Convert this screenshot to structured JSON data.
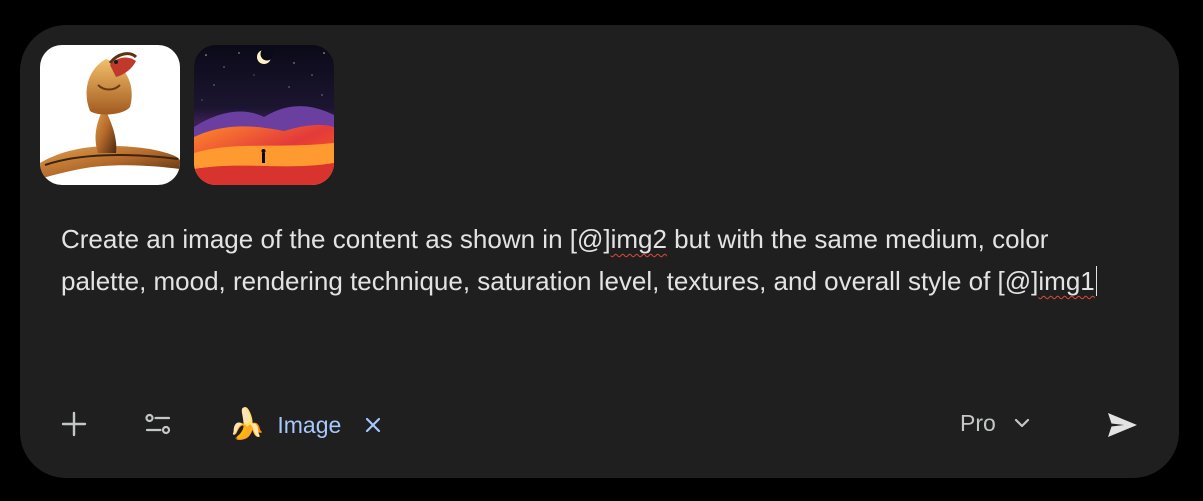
{
  "attachments": [
    {
      "icon": "cobra-image-thumbnail"
    },
    {
      "icon": "desert-night-image-thumbnail"
    }
  ],
  "prompt": {
    "before_mention1": "Create an image of the content as shown in [@]",
    "mention1": "img2",
    "middle": " but with the same medium, color palette, mood, rendering technique, saturation level, textures, and overall style of [@]",
    "mention2": "img1"
  },
  "toolbar": {
    "add_icon": "plus-icon",
    "tools_icon": "tune-icon",
    "chip": {
      "emoji": "🍌",
      "label": "Image",
      "close_icon": "close-icon"
    },
    "model": {
      "label": "Pro",
      "icon": "chevron-down-icon"
    },
    "send_icon": "send-icon"
  },
  "colors": {
    "panel": "#1f1f20",
    "text": "#e3e3e3",
    "chip_accent": "#a8c7fa"
  }
}
